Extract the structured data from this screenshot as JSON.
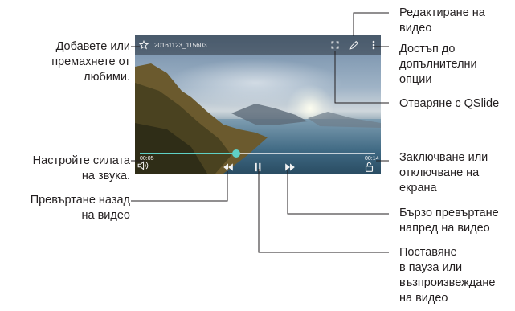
{
  "video": {
    "filename": "20161123_115603",
    "time_elapsed": "00:05",
    "time_total": "00:14",
    "progress_fraction": 0.41,
    "accent_color": "#5fd0c6"
  },
  "icons": {
    "favorite": "star-icon",
    "edit": "pencil-icon",
    "more": "more-options-icon",
    "qslide": "qslide-icon",
    "volume": "volume-icon",
    "rewind": "rewind-icon",
    "pause": "pause-icon",
    "forward": "fast-forward-icon",
    "lock": "lock-icon"
  },
  "callouts": {
    "favorites": [
      "Добавете или",
      "премахнете от",
      "любими."
    ],
    "volume": [
      "Настройте силата",
      "на звука."
    ],
    "rewind": [
      "Превъртане назад",
      "на видео"
    ],
    "edit": [
      "Редактиране на",
      "видео"
    ],
    "more": [
      "Достъп до",
      "допълнителни",
      "опции"
    ],
    "qslide": [
      "Отваряне с QSlide"
    ],
    "lock": [
      "Заключване или",
      "отключване на",
      "екрана"
    ],
    "forward": [
      "Бързо превъртане",
      "напред на видео"
    ],
    "pause": [
      "Поставяне",
      "в пауза или",
      "възпроизвеждане",
      "на видео"
    ]
  }
}
